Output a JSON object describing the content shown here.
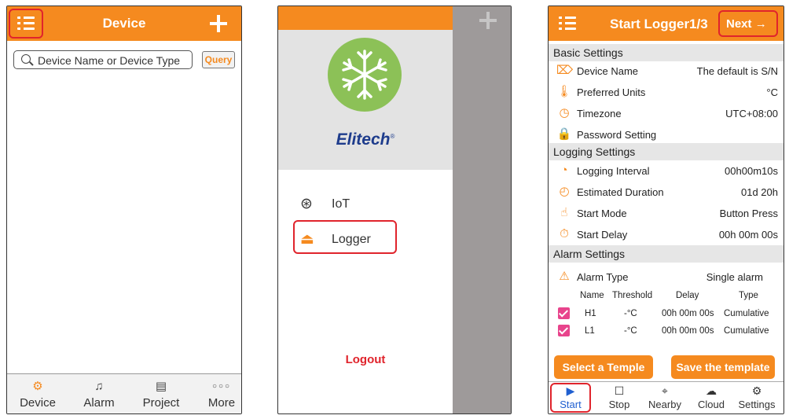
{
  "screen_device": {
    "title": "Device",
    "search_placeholder": "Device Name or Device Type",
    "query_label": "Query",
    "tabs": [
      {
        "label": "Device",
        "icon": "device-gear-icon"
      },
      {
        "label": "Alarm",
        "icon": "bell-icon"
      },
      {
        "label": "Project",
        "icon": "project-doc-icon"
      },
      {
        "label": "More",
        "icon": "more-dots-icon"
      }
    ]
  },
  "screen_menu": {
    "brand": "Elitech",
    "brand_mark": "®",
    "items": [
      {
        "label": "IoT",
        "icon": "globe-icon"
      },
      {
        "label": "Logger",
        "icon": "logger-icon"
      }
    ],
    "logout_label": "Logout"
  },
  "screen_logger": {
    "title": "Start Logger1/3",
    "next_label": "Next",
    "next_arrow": "→",
    "basic_section": "Basic Settings",
    "basic_rows": [
      {
        "label": "Device Name",
        "value": "The default is S/N",
        "icon": "tag-icon"
      },
      {
        "label": "Preferred Units",
        "value": "°C",
        "icon": "thermometer-icon"
      },
      {
        "label": "Timezone",
        "value": "UTC+08:00",
        "icon": "clock-icon"
      },
      {
        "label": "Password Setting",
        "value": "",
        "icon": "lock-icon"
      }
    ],
    "logging_section": "Logging Settings",
    "logging_rows": [
      {
        "label": "Logging Interval",
        "value": "00h00m10s",
        "icon": "interval-clock-icon"
      },
      {
        "label": "Estimated Duration",
        "value": "01d 20h",
        "icon": "duration-clock-icon"
      },
      {
        "label": "Start Mode",
        "value": "Button Press",
        "icon": "hand-press-icon"
      },
      {
        "label": "Start Delay",
        "value": "00h 00m 00s",
        "icon": "stopwatch-icon"
      }
    ],
    "alarm_section": "Alarm Settings",
    "alarm_type_label": "Alarm Type",
    "alarm_type_value": "Single alarm",
    "alarm_headers": [
      "Name",
      "Threshold",
      "Delay",
      "Type"
    ],
    "alarm_rows": [
      {
        "name": "H1",
        "threshold": "-°C",
        "delay": "00h 00m 00s",
        "type": "Cumulative",
        "checked": true
      },
      {
        "name": "L1",
        "threshold": "-°C",
        "delay": "00h 00m 00s",
        "type": "Cumulative",
        "checked": true
      }
    ],
    "select_temple_label": "Select a Temple",
    "save_template_label": "Save the template",
    "tabs": [
      {
        "label": "Start",
        "icon": "play-icon"
      },
      {
        "label": "Stop",
        "icon": "stop-icon"
      },
      {
        "label": "Nearby",
        "icon": "compass-icon"
      },
      {
        "label": "Cloud",
        "icon": "cloud-icon"
      },
      {
        "label": "Settings",
        "icon": "settings-gear-icon"
      }
    ]
  },
  "colors": {
    "brand_orange": "#f58a1f",
    "highlight_red": "#e0242c",
    "checkbox_pink": "#e8448c",
    "active_blue": "#1f5fd0",
    "logo_green": "#8cc157",
    "brand_navy": "#1e3c8c"
  }
}
